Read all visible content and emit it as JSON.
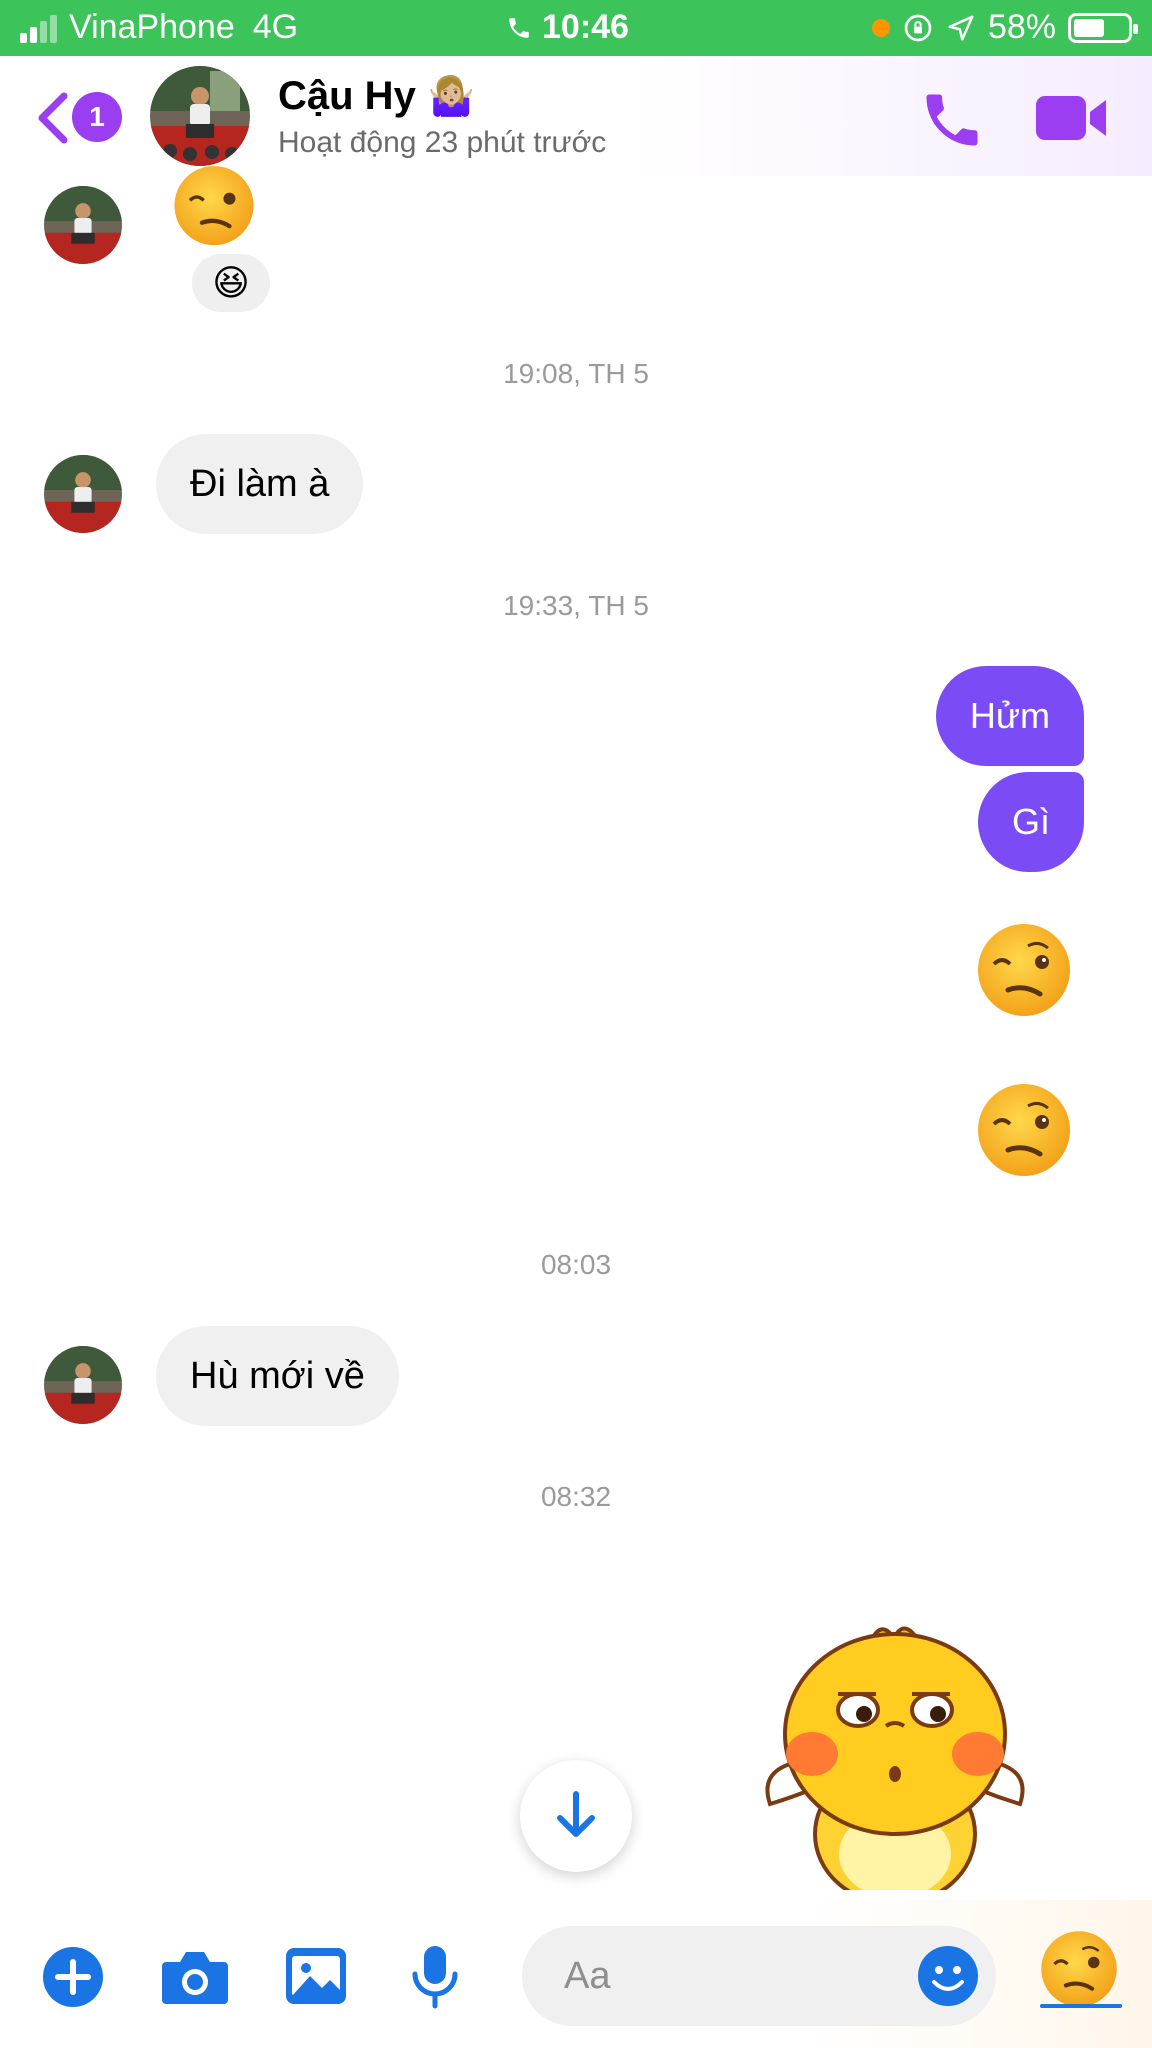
{
  "status_bar": {
    "carrier": "VinaPhone",
    "network": "4G",
    "time": "10:46",
    "battery": "58%",
    "battery_level": 0.58,
    "signal_bars": 2
  },
  "header": {
    "contact_name": "Cậu Hy",
    "contact_emoji": "🤷🏼‍♀️",
    "status": "Hoạt động 23 phút trước",
    "unread_badge": "1",
    "icons": [
      "back-chevron-icon",
      "phone-icon",
      "video-camera-icon"
    ]
  },
  "messages": {
    "reaction": "😆",
    "ts1": "19:08, TH 5",
    "msg_in_1": "Đi làm à",
    "ts2": "19:33, TH 5",
    "msg_out_1": "Hửm",
    "msg_out_2": "Gì",
    "emoji_out": "🥴",
    "ts3": "08:03",
    "msg_in_2": "Hù mới về",
    "ts4": "08:32"
  },
  "composer": {
    "placeholder": "Aa",
    "icons": [
      "plus-icon",
      "camera-icon",
      "gallery-icon",
      "microphone-icon",
      "smiley-icon",
      "woozy-face-icon"
    ]
  },
  "colors": {
    "status_green": "#3cc35a",
    "accent_purple": "#7b4cf5",
    "badge_purple": "#9b3df0",
    "messenger_blue": "#1b74e4",
    "bubble_gray": "#f0f0f0"
  }
}
